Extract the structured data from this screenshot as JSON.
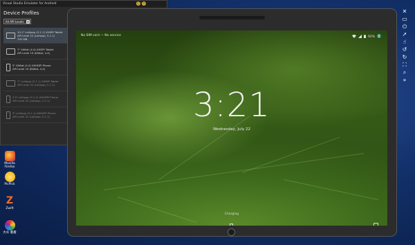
{
  "window": {
    "title": "Visual Studio Emulator for Android"
  },
  "panel": {
    "title": "Device Profiles",
    "filter_value": "All API Levels"
  },
  "profiles": [
    {
      "type": "tablet",
      "line1": "10.1\" Lollipop (5.1.1) XHDPI Tablet",
      "line2": "API Level 22 (Lollipop, 5.1.1)",
      "line3": "792 MB",
      "selected": true,
      "dim": false
    },
    {
      "type": "tablet",
      "line1": "7\" KitKat (4.4) XHDPI Tablet",
      "line2": "API Level 19 (KitKat, 4.4)",
      "line3": "",
      "selected": false,
      "dim": false
    },
    {
      "type": "phone",
      "line1": "5\" KitKat (4.4) XXHDPI Phone",
      "line2": "API Level 19 (KitKat, 4.4)",
      "line3": "",
      "selected": false,
      "dim": false
    },
    {
      "type": "tablet",
      "line1": "7\" Lollipop (5.1.1) XHDPI Tablet",
      "line2": "API Level 22 (Lollipop, 5.1.1)",
      "line3": "",
      "selected": false,
      "dim": true
    },
    {
      "type": "phone",
      "line1": "5.5\" Lollipop (5.1.1) XXHDPI Phone",
      "line2": "API Level 22 (Lollipop, 5.1.1)",
      "line3": "",
      "selected": false,
      "dim": true
    },
    {
      "type": "phone",
      "line1": "5\" Lollipop (5.1.1) XXHDPI Phone",
      "line2": "API Level 22 (Lollipop, 5.1.1)",
      "line3": "",
      "selected": false,
      "dim": true
    }
  ],
  "device": {
    "carrier_text": "No SIM card — No service",
    "battery_text": "92%",
    "time": "3:21",
    "date": "Wednesday, July 22",
    "charging_text": "Charging"
  },
  "toolbar": {
    "buttons": [
      "close-icon",
      "minimize-icon",
      "power-icon",
      "pointer-icon",
      "touch-icon",
      "rotate-left-icon",
      "rotate-right-icon",
      "fit-to-screen-icon",
      "zoom-icon",
      "more-icon"
    ],
    "glyphs": [
      "✕",
      "▭",
      "⏻",
      "➚",
      "☝",
      "↺",
      "↻",
      "⛶",
      "⌕",
      "»"
    ]
  },
  "desktop": {
    "icons": [
      {
        "label": "Mozilla Firefox",
        "color": "#e8622a"
      },
      {
        "label": "PicPick",
        "color": "#f4b81c"
      },
      {
        "label": "Zwift",
        "color": "#f46a1f"
      },
      {
        "label": "大众 看看",
        "color": "#2ca44a"
      }
    ]
  },
  "colors": {
    "accent_selected": "#3e4650",
    "screen_green": "#3e6a1c"
  }
}
